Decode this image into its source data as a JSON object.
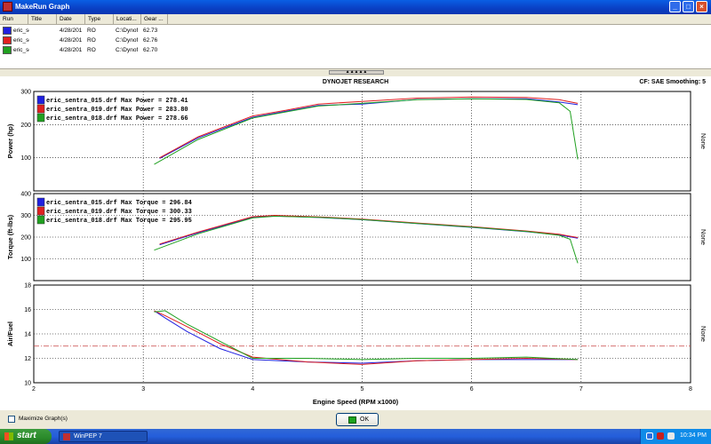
{
  "window": {
    "title": "MakeRun Graph"
  },
  "runs": {
    "columns": [
      "Run",
      "Title",
      "Date",
      "Type",
      "Locati...",
      "Gear ..."
    ],
    "rows": [
      {
        "run": "eric_se",
        "date": "4/28/201",
        "type": "RO",
        "location": "C:\\Dynof",
        "gear": "62.73",
        "color": "#2020e0"
      },
      {
        "run": "eric_se",
        "date": "4/28/201",
        "type": "RO",
        "location": "C:\\Dynof",
        "gear": "62.76",
        "color": "#e02020"
      },
      {
        "run": "eric_se",
        "date": "4/28/201",
        "type": "RO",
        "location": "C:\\Dynof",
        "gear": "62.70",
        "color": "#20a020"
      }
    ]
  },
  "splitter": {
    "grip": "▲▲▲▲▲"
  },
  "graph": {
    "header_center": "DYNOJET RESEARCH",
    "header_right": "CF: SAE  Smoothing: 5",
    "side_label": "None",
    "xlabel": "Engine Speed (RPM x1000)",
    "x_ticks": [
      "2",
      "3",
      "4",
      "5",
      "6",
      "7",
      "8"
    ]
  },
  "chart_data": [
    {
      "type": "line",
      "ylabel": "Power (hp)",
      "xlim": [
        2,
        8
      ],
      "ylim": [
        0,
        300
      ],
      "y_ticks": [
        "100",
        "200",
        "300"
      ],
      "legend": [
        "eric_sentra_015.drf Max Power = 278.41",
        "eric_sentra_019.drf Max Power = 283.80",
        "eric_sentra_018.drf Max Power = 278.66"
      ],
      "series": [
        {
          "name": "eric_sentra_015.drf",
          "color": "#2020e0",
          "x": [
            3.15,
            3.5,
            4.0,
            4.3,
            4.6,
            5.0,
            5.5,
            6.0,
            6.5,
            6.8,
            6.97
          ],
          "y": [
            98,
            160,
            222,
            240,
            258,
            262,
            276,
            278,
            278,
            268,
            260
          ]
        },
        {
          "name": "eric_sentra_019.drf",
          "color": "#e02020",
          "x": [
            3.15,
            3.5,
            4.0,
            4.3,
            4.6,
            5.0,
            5.5,
            6.0,
            6.5,
            6.8,
            6.97
          ],
          "y": [
            100,
            163,
            226,
            243,
            262,
            270,
            280,
            283,
            282,
            275,
            264
          ]
        },
        {
          "name": "eric_sentra_018.drf",
          "color": "#20a020",
          "x": [
            3.1,
            3.5,
            4.0,
            4.3,
            4.6,
            5.0,
            5.5,
            6.0,
            6.5,
            6.8,
            6.9,
            6.97
          ],
          "y": [
            80,
            155,
            220,
            238,
            256,
            264,
            275,
            278,
            276,
            266,
            240,
            95
          ]
        }
      ]
    },
    {
      "type": "line",
      "ylabel": "Torque (ft-lbs)",
      "xlim": [
        2,
        8
      ],
      "ylim": [
        0,
        400
      ],
      "y_ticks": [
        "100",
        "200",
        "300",
        "400"
      ],
      "legend": [
        "eric_sentra_015.drf Max Torque = 296.84",
        "eric_sentra_019.drf Max Torque = 300.33",
        "eric_sentra_018.drf Max Torque = 295.95"
      ],
      "series": [
        {
          "name": "eric_sentra_015.drf",
          "color": "#2020e0",
          "x": [
            3.15,
            3.5,
            4.0,
            4.2,
            4.6,
            5.0,
            5.5,
            6.0,
            6.5,
            6.8,
            6.97
          ],
          "y": [
            165,
            220,
            290,
            297,
            290,
            280,
            262,
            245,
            225,
            210,
            195
          ]
        },
        {
          "name": "eric_sentra_019.drf",
          "color": "#e02020",
          "x": [
            3.15,
            3.5,
            4.0,
            4.2,
            4.6,
            5.0,
            5.5,
            6.0,
            6.5,
            6.8,
            6.97
          ],
          "y": [
            168,
            223,
            294,
            300,
            293,
            283,
            265,
            248,
            228,
            213,
            198
          ]
        },
        {
          "name": "eric_sentra_018.drf",
          "color": "#20a020",
          "x": [
            3.1,
            3.5,
            4.0,
            4.2,
            4.6,
            5.0,
            5.5,
            6.0,
            6.5,
            6.8,
            6.9,
            6.97
          ],
          "y": [
            140,
            215,
            288,
            296,
            291,
            281,
            263,
            246,
            226,
            208,
            190,
            80
          ]
        }
      ]
    },
    {
      "type": "line",
      "ylabel": "Air/Fuel",
      "xlim": [
        2,
        8
      ],
      "ylim": [
        10,
        18
      ],
      "y_ticks": [
        "10",
        "12",
        "14",
        "16",
        "18"
      ],
      "reference_line": 13,
      "series": [
        {
          "name": "eric_sentra_015.drf",
          "color": "#2020e0",
          "x": [
            3.1,
            3.2,
            3.4,
            3.7,
            4.0,
            4.5,
            5.0,
            5.5,
            6.0,
            6.5,
            6.97
          ],
          "y": [
            15.9,
            15.3,
            14.2,
            12.8,
            11.9,
            11.7,
            11.6,
            11.8,
            11.9,
            11.9,
            11.9
          ]
        },
        {
          "name": "eric_sentra_019.drf",
          "color": "#e02020",
          "x": [
            3.1,
            3.2,
            3.4,
            3.7,
            4.0,
            4.5,
            5.0,
            5.5,
            6.0,
            6.5,
            6.97
          ],
          "y": [
            15.9,
            15.5,
            14.6,
            13.2,
            12.1,
            11.7,
            11.5,
            11.8,
            11.9,
            12.0,
            11.9
          ]
        },
        {
          "name": "eric_sentra_018.drf",
          "color": "#20a020",
          "x": [
            3.1,
            3.2,
            3.4,
            3.7,
            4.0,
            4.5,
            5.0,
            5.5,
            6.0,
            6.5,
            6.97
          ],
          "y": [
            15.8,
            15.9,
            14.8,
            13.4,
            12.0,
            12.0,
            11.9,
            12.0,
            12.0,
            12.1,
            11.9
          ]
        }
      ]
    }
  ],
  "bottom": {
    "maximize_label": "Maximize Graph(s)",
    "ok_label": "OK"
  },
  "taskbar": {
    "start_label": "start",
    "task_label": "WinPEP 7",
    "clock": "10:34 PM"
  }
}
